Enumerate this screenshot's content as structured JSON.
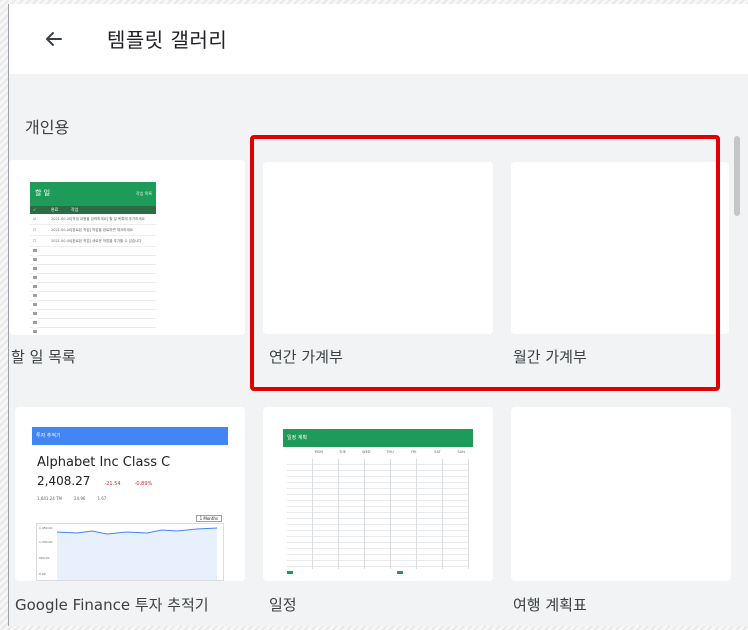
{
  "header": {
    "title": "템플릿 갤러리",
    "back_icon": "arrow-left-icon"
  },
  "section": {
    "label": "개인용"
  },
  "templates": [
    {
      "label": "할 일 목록",
      "thumb": {
        "title": "할 일",
        "sub": "작업 목록",
        "col1": "완료",
        "col2": "작업",
        "rows": [
          {
            "date": "2021.00.00",
            "text": "[작업 내용을 입력하세요] 할 일 목록에 추가하세요"
          },
          {
            "date": "2021.00.00",
            "text": "[완료된 작업] 작업을 완료하면 체크하세요"
          },
          {
            "date": "2021.00.00",
            "text": "[완료된 작업] 새로운 작업을 추가할 수 있습니다"
          }
        ]
      }
    },
    {
      "label": "연간 가계부"
    },
    {
      "label": "월간 가계부"
    },
    {
      "label": "Google Finance 투자 추적기",
      "thumb": {
        "header": "투자 추적기",
        "heading": "Alphabet Inc Class C",
        "price": "2,408.27",
        "change": "-21.54",
        "pct": "-0.89%",
        "mcap": "1,641.24 TM",
        "pe": "24.96",
        "div": "1.67",
        "range": "1 Months",
        "y1": "1,450.00",
        "y2": "1,300.00",
        "y3": "900.00",
        "y4": "0.00"
      }
    },
    {
      "label": "일정",
      "thumb": {
        "title": "일정 계획",
        "days": [
          "MON",
          "TUE",
          "WED",
          "THU",
          "FRI",
          "SAT",
          "SUN"
        ]
      }
    },
    {
      "label": "여행 계획표"
    }
  ],
  "colors": {
    "highlight": "#e00000",
    "sheet_green": "#1e9b59",
    "finance_blue": "#4285f4"
  }
}
